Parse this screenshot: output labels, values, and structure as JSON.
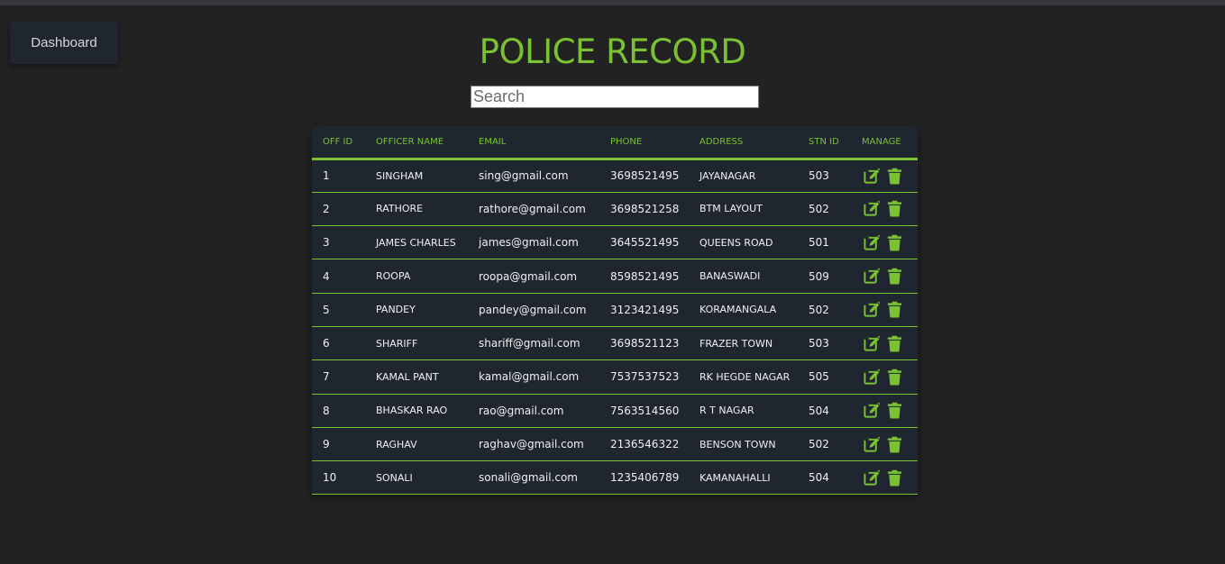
{
  "dashboard_label": "Dashboard",
  "title": "POLICE RECORD",
  "search": {
    "placeholder": "Search",
    "value": ""
  },
  "colors": {
    "accent": "#7ac231",
    "background": "#222222",
    "table_bg": "#1f2630"
  },
  "icons": {
    "edit": "edit-icon",
    "delete": "trash-icon"
  },
  "table": {
    "headers": [
      "OFF ID",
      "OFFICER NAME",
      "EMAIL",
      "PHONE",
      "ADDRESS",
      "STN ID",
      "MANAGE"
    ],
    "rows": [
      {
        "id": "1",
        "name": "SINGHAM",
        "email": "sing@gmail.com",
        "phone": "3698521495",
        "address": "JAYANAGAR",
        "stn": "503"
      },
      {
        "id": "2",
        "name": "RATHORE",
        "email": "rathore@gmail.com",
        "phone": "3698521258",
        "address": "BTM LAYOUT",
        "stn": "502"
      },
      {
        "id": "3",
        "name": "JAMES CHARLES",
        "email": "james@gmail.com",
        "phone": "3645521495",
        "address": "QUEENS ROAD",
        "stn": "501"
      },
      {
        "id": "4",
        "name": "ROOPA",
        "email": "roopa@gmail.com",
        "phone": "8598521495",
        "address": "BANASWADI",
        "stn": "509"
      },
      {
        "id": "5",
        "name": "PANDEY",
        "email": "pandey@gmail.com",
        "phone": "3123421495",
        "address": "KORAMANGALA",
        "stn": "502"
      },
      {
        "id": "6",
        "name": "SHARIFF",
        "email": "shariff@gmail.com",
        "phone": "3698521123",
        "address": "FRAZER TOWN",
        "stn": "503"
      },
      {
        "id": "7",
        "name": "KAMAL PANT",
        "email": "kamal@gmail.com",
        "phone": "7537537523",
        "address": "RK HEGDE NAGAR",
        "stn": "505"
      },
      {
        "id": "8",
        "name": "BHASKAR RAO",
        "email": "rao@gmail.com",
        "phone": "7563514560",
        "address": "R T NAGAR",
        "stn": "504"
      },
      {
        "id": "9",
        "name": "RAGHAV",
        "email": "raghav@gmail.com",
        "phone": "2136546322",
        "address": "BENSON TOWN",
        "stn": "502"
      },
      {
        "id": "10",
        "name": "SONALI",
        "email": "sonali@gmail.com",
        "phone": "1235406789",
        "address": "KAMANAHALLI",
        "stn": "504"
      }
    ]
  }
}
